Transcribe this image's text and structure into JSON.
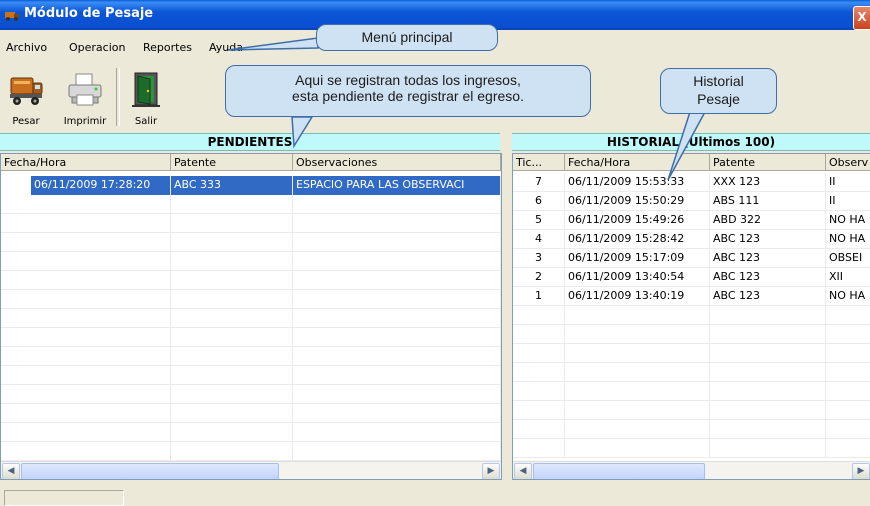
{
  "window": {
    "title": "Módulo de Pesaje",
    "close_label": "X"
  },
  "menu": {
    "items": [
      "Archivo",
      "Operacion",
      "Reportes",
      "Ayuda"
    ]
  },
  "toolbar": {
    "pesar": "Pesar",
    "imprimir": "Imprimir",
    "salir": "Salir"
  },
  "pendientes": {
    "header": "PENDIENTES",
    "columns": [
      "Fecha/Hora",
      "Patente",
      "Observaciones"
    ],
    "rows": [
      {
        "fecha": "06/11/2009 17:28:20",
        "patente": "ABC 333",
        "obs": "ESPACIO PARA LAS OBSERVACI"
      }
    ]
  },
  "historial": {
    "header": "HISTORIAL (Ultimos 100)",
    "columns": [
      "Tic...",
      "Fecha/Hora",
      "Patente",
      "Observ"
    ],
    "rows": [
      {
        "tic": "7",
        "fecha": "06/11/2009 15:53:33",
        "patente": "XXX 123",
        "obs": "II"
      },
      {
        "tic": "6",
        "fecha": "06/11/2009 15:50:29",
        "patente": "ABS 111",
        "obs": "II"
      },
      {
        "tic": "5",
        "fecha": "06/11/2009 15:49:26",
        "patente": "ABD 322",
        "obs": "NO HA"
      },
      {
        "tic": "4",
        "fecha": "06/11/2009 15:28:42",
        "patente": "ABC 123",
        "obs": "NO HA"
      },
      {
        "tic": "3",
        "fecha": "06/11/2009 15:17:09",
        "patente": "ABC 123",
        "obs": "OBSEI"
      },
      {
        "tic": "2",
        "fecha": "06/11/2009 13:40:54",
        "patente": "ABC 123",
        "obs": "XII"
      },
      {
        "tic": "1",
        "fecha": "06/11/2009 13:40:19",
        "patente": "ABC 123",
        "obs": "NO HA"
      }
    ]
  },
  "callouts": {
    "menu": "Menú principal",
    "ingresos_line1": "Aqui se registran todas los ingresos,",
    "ingresos_line2": "esta pendiente de registrar el egreso.",
    "historial_line1": "Historial",
    "historial_line2": "Pesaje"
  },
  "colors": {
    "title_bar": "#0a56d6",
    "header_bg": "#bff9fb",
    "selection": "#316ac5",
    "callout_bg": "#cfe2f3"
  }
}
